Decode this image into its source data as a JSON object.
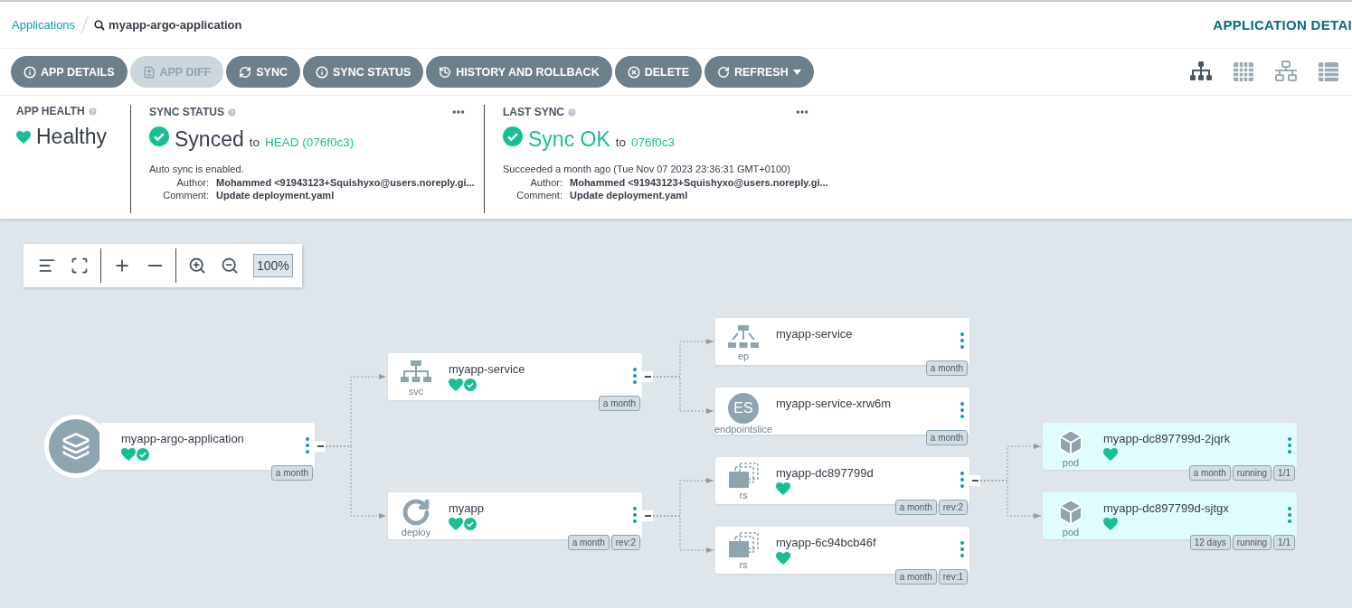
{
  "breadcrumb": {
    "link": "Applications",
    "current": "myapp-argo-application"
  },
  "page_title": "APPLICATION DETAI",
  "actions": [
    {
      "label": "APP DETAILS",
      "kind": "info",
      "disabled": false
    },
    {
      "label": "APP DIFF",
      "kind": "diff",
      "disabled": true
    },
    {
      "label": "SYNC",
      "kind": "sync",
      "disabled": false
    },
    {
      "label": "SYNC STATUS",
      "kind": "info",
      "disabled": false
    },
    {
      "label": "HISTORY AND ROLLBACK",
      "kind": "history",
      "disabled": false
    },
    {
      "label": "DELETE",
      "kind": "delete",
      "disabled": false
    },
    {
      "label": "REFRESH",
      "kind": "refresh",
      "disabled": false,
      "dropdown": true
    }
  ],
  "view_modes": [
    {
      "kind": "tree",
      "selected": true
    },
    {
      "kind": "pods",
      "selected": false
    },
    {
      "kind": "network",
      "selected": false
    },
    {
      "kind": "list",
      "selected": false
    }
  ],
  "status_panels": [
    {
      "kind": "health",
      "label": "APP HEALTH",
      "value": "Healthy"
    },
    {
      "kind": "sync",
      "label": "SYNC STATUS",
      "value": "Synced",
      "to": "to",
      "revision": "HEAD (076f0c3)",
      "note": "Auto sync is enabled.",
      "fields": [
        {
          "key": "Author:",
          "value": "Mohammed <91943123+Squishyxo@users.noreply.gi..."
        },
        {
          "key": "Comment:",
          "value": "Update deployment.yaml"
        }
      ]
    },
    {
      "kind": "last_sync",
      "label": "LAST SYNC",
      "value": "Sync OK",
      "to": "to",
      "revision": "076f0c3",
      "note": "Succeeded a month ago (Tue Nov 07 2023 23:36:31 GMT+0100)",
      "fields": [
        {
          "key": "Author:",
          "value": "Mohammed <91943123+Squishyxo@users.noreply.gi..."
        },
        {
          "key": "Comment:",
          "value": "Update deployment.yaml"
        }
      ]
    }
  ],
  "graph": {
    "tools": [
      {
        "kind": "align"
      },
      {
        "kind": "fit"
      },
      {
        "kind": "plus"
      },
      {
        "kind": "minus"
      },
      {
        "kind": "zoom_in"
      },
      {
        "kind": "zoom_out"
      }
    ],
    "zoom_level": "100%",
    "root": {
      "name": "myapp-argo-application",
      "kind": "application",
      "healthy": true,
      "synced": true,
      "tags": [
        "a month"
      ],
      "expanded": true,
      "highlighted": false,
      "children": [
        {
          "name": "myapp-service",
          "kind": "service",
          "type": "svc",
          "healthy": true,
          "synced": true,
          "tags": [
            "a month"
          ],
          "expanded": true,
          "highlighted": false,
          "children": [
            {
              "name": "myapp-service",
              "kind": "endpoints",
              "type": "ep",
              "tags": [
                "a month"
              ],
              "highlighted": false
            },
            {
              "name": "myapp-service-xrw6m",
              "kind": "letters",
              "icon_text": "ES",
              "type": "endpointslice",
              "tags": [
                "a month"
              ],
              "highlighted": false
            }
          ]
        },
        {
          "name": "myapp",
          "kind": "deployment",
          "type": "deploy",
          "healthy": true,
          "synced": true,
          "tags": [
            "a month",
            "rev:2"
          ],
          "expanded": true,
          "highlighted": false,
          "children": [
            {
              "name": "myapp-dc897799d",
              "kind": "replicaset",
              "type": "rs",
              "healthy": true,
              "tags": [
                "a month",
                "rev:2"
              ],
              "expanded": true,
              "highlighted": false,
              "children": [
                {
                  "name": "myapp-dc897799d-2jqrk",
                  "kind": "container",
                  "type": "pod",
                  "healthy": true,
                  "tags": [
                    "a month",
                    "running",
                    "1/1"
                  ],
                  "highlighted": true
                },
                {
                  "name": "myapp-dc897799d-sjtgx",
                  "kind": "container",
                  "type": "pod",
                  "healthy": true,
                  "tags": [
                    "12 days",
                    "running",
                    "1/1"
                  ],
                  "highlighted": true
                }
              ]
            },
            {
              "name": "myapp-6c94bcb46f",
              "kind": "replicaset",
              "type": "rs",
              "healthy": true,
              "tags": [
                "a month",
                "rev:1"
              ],
              "highlighted": false
            }
          ]
        }
      ]
    }
  }
}
